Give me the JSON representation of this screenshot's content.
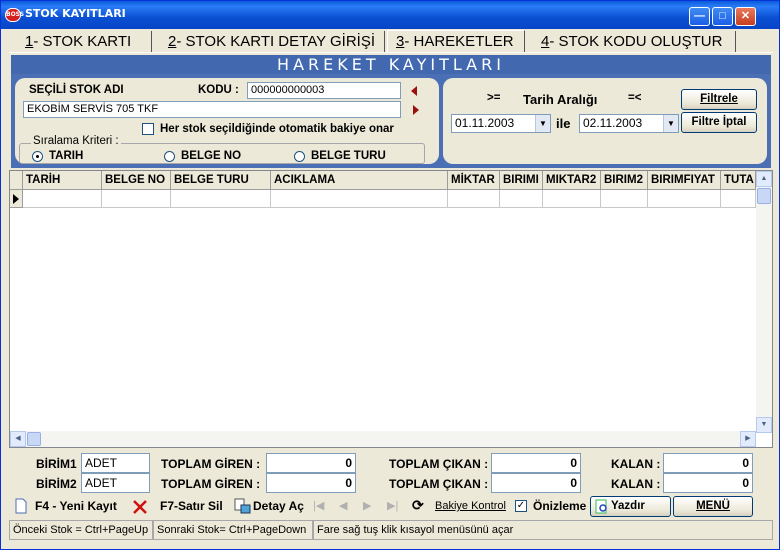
{
  "window": {
    "title": "STOK KAYITLARI",
    "icon_text": "BOSS",
    "controls": [
      "minimize-icon",
      "maximize-icon",
      "close-icon"
    ]
  },
  "tabs": [
    {
      "hotkey": "1",
      "label": "- STOK KARTI"
    },
    {
      "hotkey": "2",
      "label": "- STOK KARTI DETAY GİRİŞİ"
    },
    {
      "hotkey": "3",
      "label": "- HAREKETLER",
      "active": true
    },
    {
      "hotkey": "4",
      "label": "- STOK KODU OLUŞTUR"
    }
  ],
  "banner": "HAREKET KAYITLARI",
  "stock": {
    "selected_label": "SEÇİLİ STOK ADI",
    "code_label": "KODU :",
    "code_value": "000000000003",
    "name_value": "EKOBİM SERVİS 705 TKF",
    "auto_balance_label": "Her stok seçildiğinde otomatik bakiye onar"
  },
  "sort": {
    "title": "Sıralama Kriteri :",
    "options": [
      "TARIH",
      "BELGE NO",
      "BELGE TURU"
    ],
    "selected": "TARIH"
  },
  "date_filter": {
    "gte_label": ">=",
    "title": "Tarih Aralığı",
    "lte_label": "=<",
    "from": "01.11.2003",
    "between_label": "ile",
    "to": "02.11.2003",
    "filter_button": "Filtrele",
    "cancel_button": "Filtre İptal"
  },
  "grid": {
    "columns": [
      "TARİH",
      "BELGE NO",
      "BELGE TURU",
      "ACIKLAMA",
      "MİKTAR",
      "BIRIMI",
      "MIKTAR2",
      "BIRIM2",
      "BIRIMFIYAT",
      "TUTA"
    ]
  },
  "totals": {
    "unit1_label": "BİRİM1",
    "unit1_value": "ADET",
    "unit2_label": "BİRİM2",
    "unit2_value": "ADET",
    "in_label": "TOPLAM GİREN :",
    "out_label": "TOPLAM ÇIKAN :",
    "balance_label": "KALAN :",
    "in1": "0",
    "out1": "0",
    "balance1": "0",
    "in2": "0",
    "out2": "0",
    "balance2": "0"
  },
  "toolbar": {
    "new_record": "F4 - Yeni Kayıt",
    "delete_row": "F7-Satır Sil",
    "open_detail": "Detay Aç",
    "balance_check": "Bakiye Kontrol",
    "preview": "Önizleme",
    "print": "Yazdır",
    "menu": "MENÜ"
  },
  "status": {
    "prev": "Önceki Stok = Ctrl+PageUp",
    "next": "Sonraki Stok= Ctrl+PageDown",
    "hint": "Fare sağ tuş klik kısayol menüsünü açar"
  }
}
